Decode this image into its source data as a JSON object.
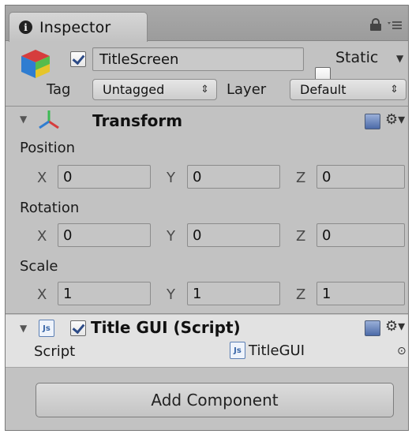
{
  "tab": {
    "title": "Inspector",
    "info_glyph": "i"
  },
  "gameobject": {
    "name": "TitleScreen",
    "active": true,
    "static_label": "Static",
    "static": false,
    "tag_label": "Tag",
    "tag_value": "Untagged",
    "layer_label": "Layer",
    "layer_value": "Default"
  },
  "transform": {
    "title": "Transform",
    "position": {
      "label": "Position",
      "x": "0",
      "y": "0",
      "z": "0"
    },
    "rotation": {
      "label": "Rotation",
      "x": "0",
      "y": "0",
      "z": "0"
    },
    "scale": {
      "label": "Scale",
      "x": "1",
      "y": "1",
      "z": "1"
    },
    "axis_x": "X",
    "axis_y": "Y",
    "axis_z": "Z"
  },
  "script_component": {
    "title": "Title GUI (Script)",
    "enabled": true,
    "field_label": "Script",
    "field_value": "TitleGUI",
    "js_glyph": "Js"
  },
  "add_component_label": "Add Component",
  "icons": [
    "info-icon",
    "lock-icon",
    "menu-icon",
    "gameobject-cube-icon",
    "transform-axis-icon",
    "help-book-icon",
    "gear-icon",
    "js-script-icon",
    "object-picker-icon"
  ]
}
